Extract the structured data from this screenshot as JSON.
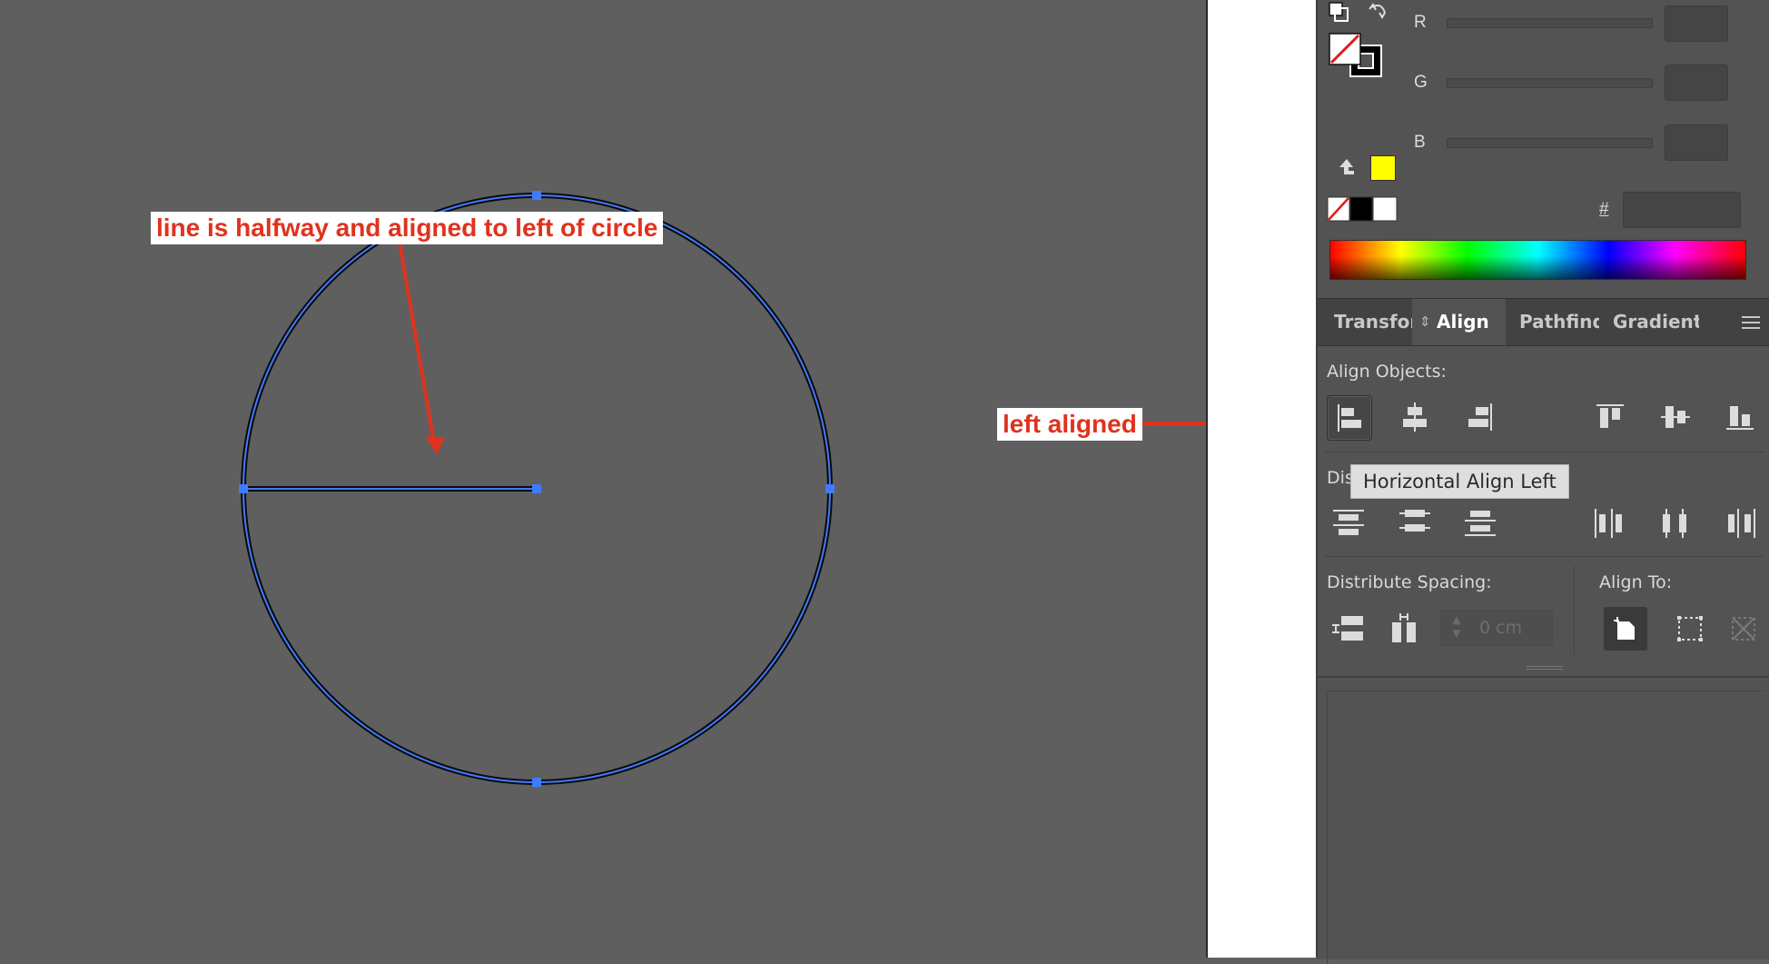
{
  "annotations": {
    "circle_note": "line is halfway and aligned to left of circle",
    "panel_note": "left aligned"
  },
  "colors": {
    "annotation_text": "#e0321e",
    "selection_blue": "#3f7bff",
    "panel_bg": "#535353",
    "canvas_bg": "#5f5f5f",
    "swatch_yellow": "#ffff00"
  },
  "color_panel": {
    "channels": [
      {
        "label": "R",
        "value": ""
      },
      {
        "label": "G",
        "value": ""
      },
      {
        "label": "B",
        "value": ""
      }
    ],
    "hex_label": "#",
    "hex_value": ""
  },
  "tabs": [
    {
      "label": "Transform",
      "display": "Transfor",
      "active": false
    },
    {
      "label": "Align",
      "active": true
    },
    {
      "label": "Pathfinder",
      "display": "Pathfind",
      "active": false
    },
    {
      "label": "Gradient",
      "active": false
    }
  ],
  "align_panel": {
    "align_objects_label": "Align Objects:",
    "distribute_objects_label": "Dis",
    "distribute_spacing_label": "Distribute Spacing:",
    "align_to_label": "Align To:",
    "spacing_value": "0 cm",
    "tooltip": "Horizontal Align Left",
    "align_buttons": [
      {
        "name": "horizontal-align-left",
        "selected": true
      },
      {
        "name": "horizontal-align-center",
        "selected": false
      },
      {
        "name": "horizontal-align-right",
        "selected": false
      },
      {
        "name": "vertical-align-top",
        "selected": false
      },
      {
        "name": "vertical-align-center",
        "selected": false
      },
      {
        "name": "vertical-align-bottom",
        "selected": false
      }
    ],
    "align_to_buttons": [
      {
        "name": "align-to-artboard",
        "selected": true
      },
      {
        "name": "align-to-selection",
        "selected": false
      },
      {
        "name": "align-to-key-object",
        "selected": false
      }
    ]
  }
}
